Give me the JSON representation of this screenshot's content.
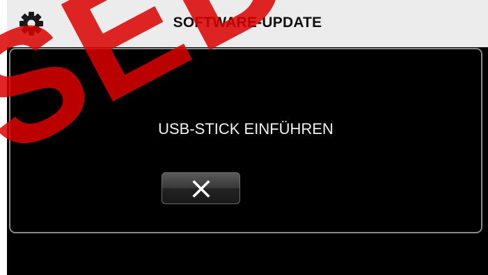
{
  "header": {
    "title": "SOFTWARE-UPDATE",
    "settings_icon": "gear-icon"
  },
  "dialog": {
    "message": "USB-STICK EINFÜHREN",
    "close_icon": "close-icon"
  },
  "watermark": {
    "text": "SEDE"
  },
  "colors": {
    "header_bg": "#ececec",
    "screen_bg": "#000000",
    "dialog_border": "#8a8a8a",
    "watermark": "#dc0000"
  }
}
